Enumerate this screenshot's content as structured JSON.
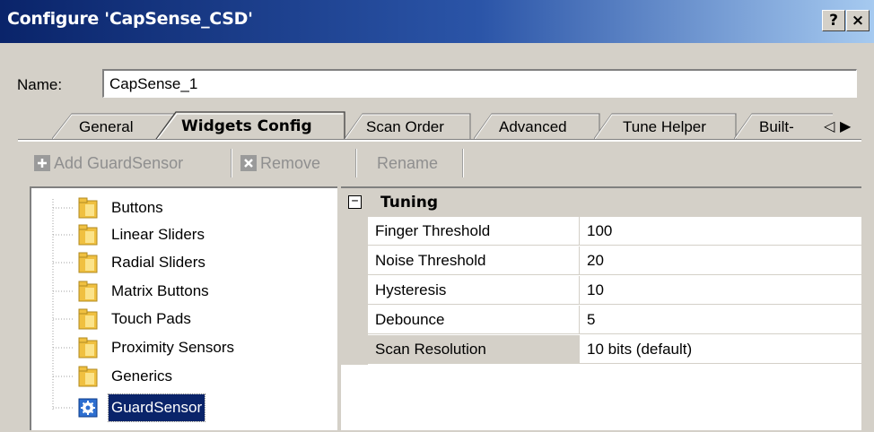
{
  "window": {
    "title": "Configure 'CapSense_CSD'",
    "help_label": "?",
    "close_label": "×"
  },
  "name_field": {
    "label": "Name:",
    "value": "CapSense_1"
  },
  "tabs": [
    {
      "label": "General",
      "active": false
    },
    {
      "label": "Widgets Config",
      "active": true
    },
    {
      "label": "Scan Order",
      "active": false
    },
    {
      "label": "Advanced",
      "active": false
    },
    {
      "label": "Tune Helper",
      "active": false
    },
    {
      "label": "Built-",
      "active": false
    }
  ],
  "tab_scroll": {
    "left": "◁",
    "right": "▶"
  },
  "toolbar": {
    "add_label": "Add GuardSensor",
    "remove_label": "Remove",
    "rename_label": "Rename"
  },
  "tree": {
    "items": [
      {
        "label": "Buttons",
        "icon": "folder-icon"
      },
      {
        "label": "Linear Sliders",
        "icon": "folder-icon"
      },
      {
        "label": "Radial Sliders",
        "icon": "folder-icon"
      },
      {
        "label": "Matrix Buttons",
        "icon": "folder-icon"
      },
      {
        "label": "Touch Pads",
        "icon": "folder-icon"
      },
      {
        "label": "Proximity Sensors",
        "icon": "folder-icon"
      },
      {
        "label": "Generics",
        "icon": "folder-icon"
      },
      {
        "label": "GuardSensor",
        "icon": "gear-icon",
        "selected": true
      }
    ]
  },
  "properties": {
    "category": "Tuning",
    "collapse_symbol": "−",
    "rows": [
      {
        "name": "Finger Threshold",
        "value": "100"
      },
      {
        "name": "Noise Threshold",
        "value": "20"
      },
      {
        "name": "Hysteresis",
        "value": "10"
      },
      {
        "name": "Debounce",
        "value": "5"
      },
      {
        "name": "Scan Resolution",
        "value": "10 bits (default)",
        "selected": true
      }
    ]
  },
  "colors": {
    "title_start": "#0a246a",
    "title_end": "#a6caf0",
    "face": "#d4d0c8",
    "selection": "#0a246a"
  }
}
